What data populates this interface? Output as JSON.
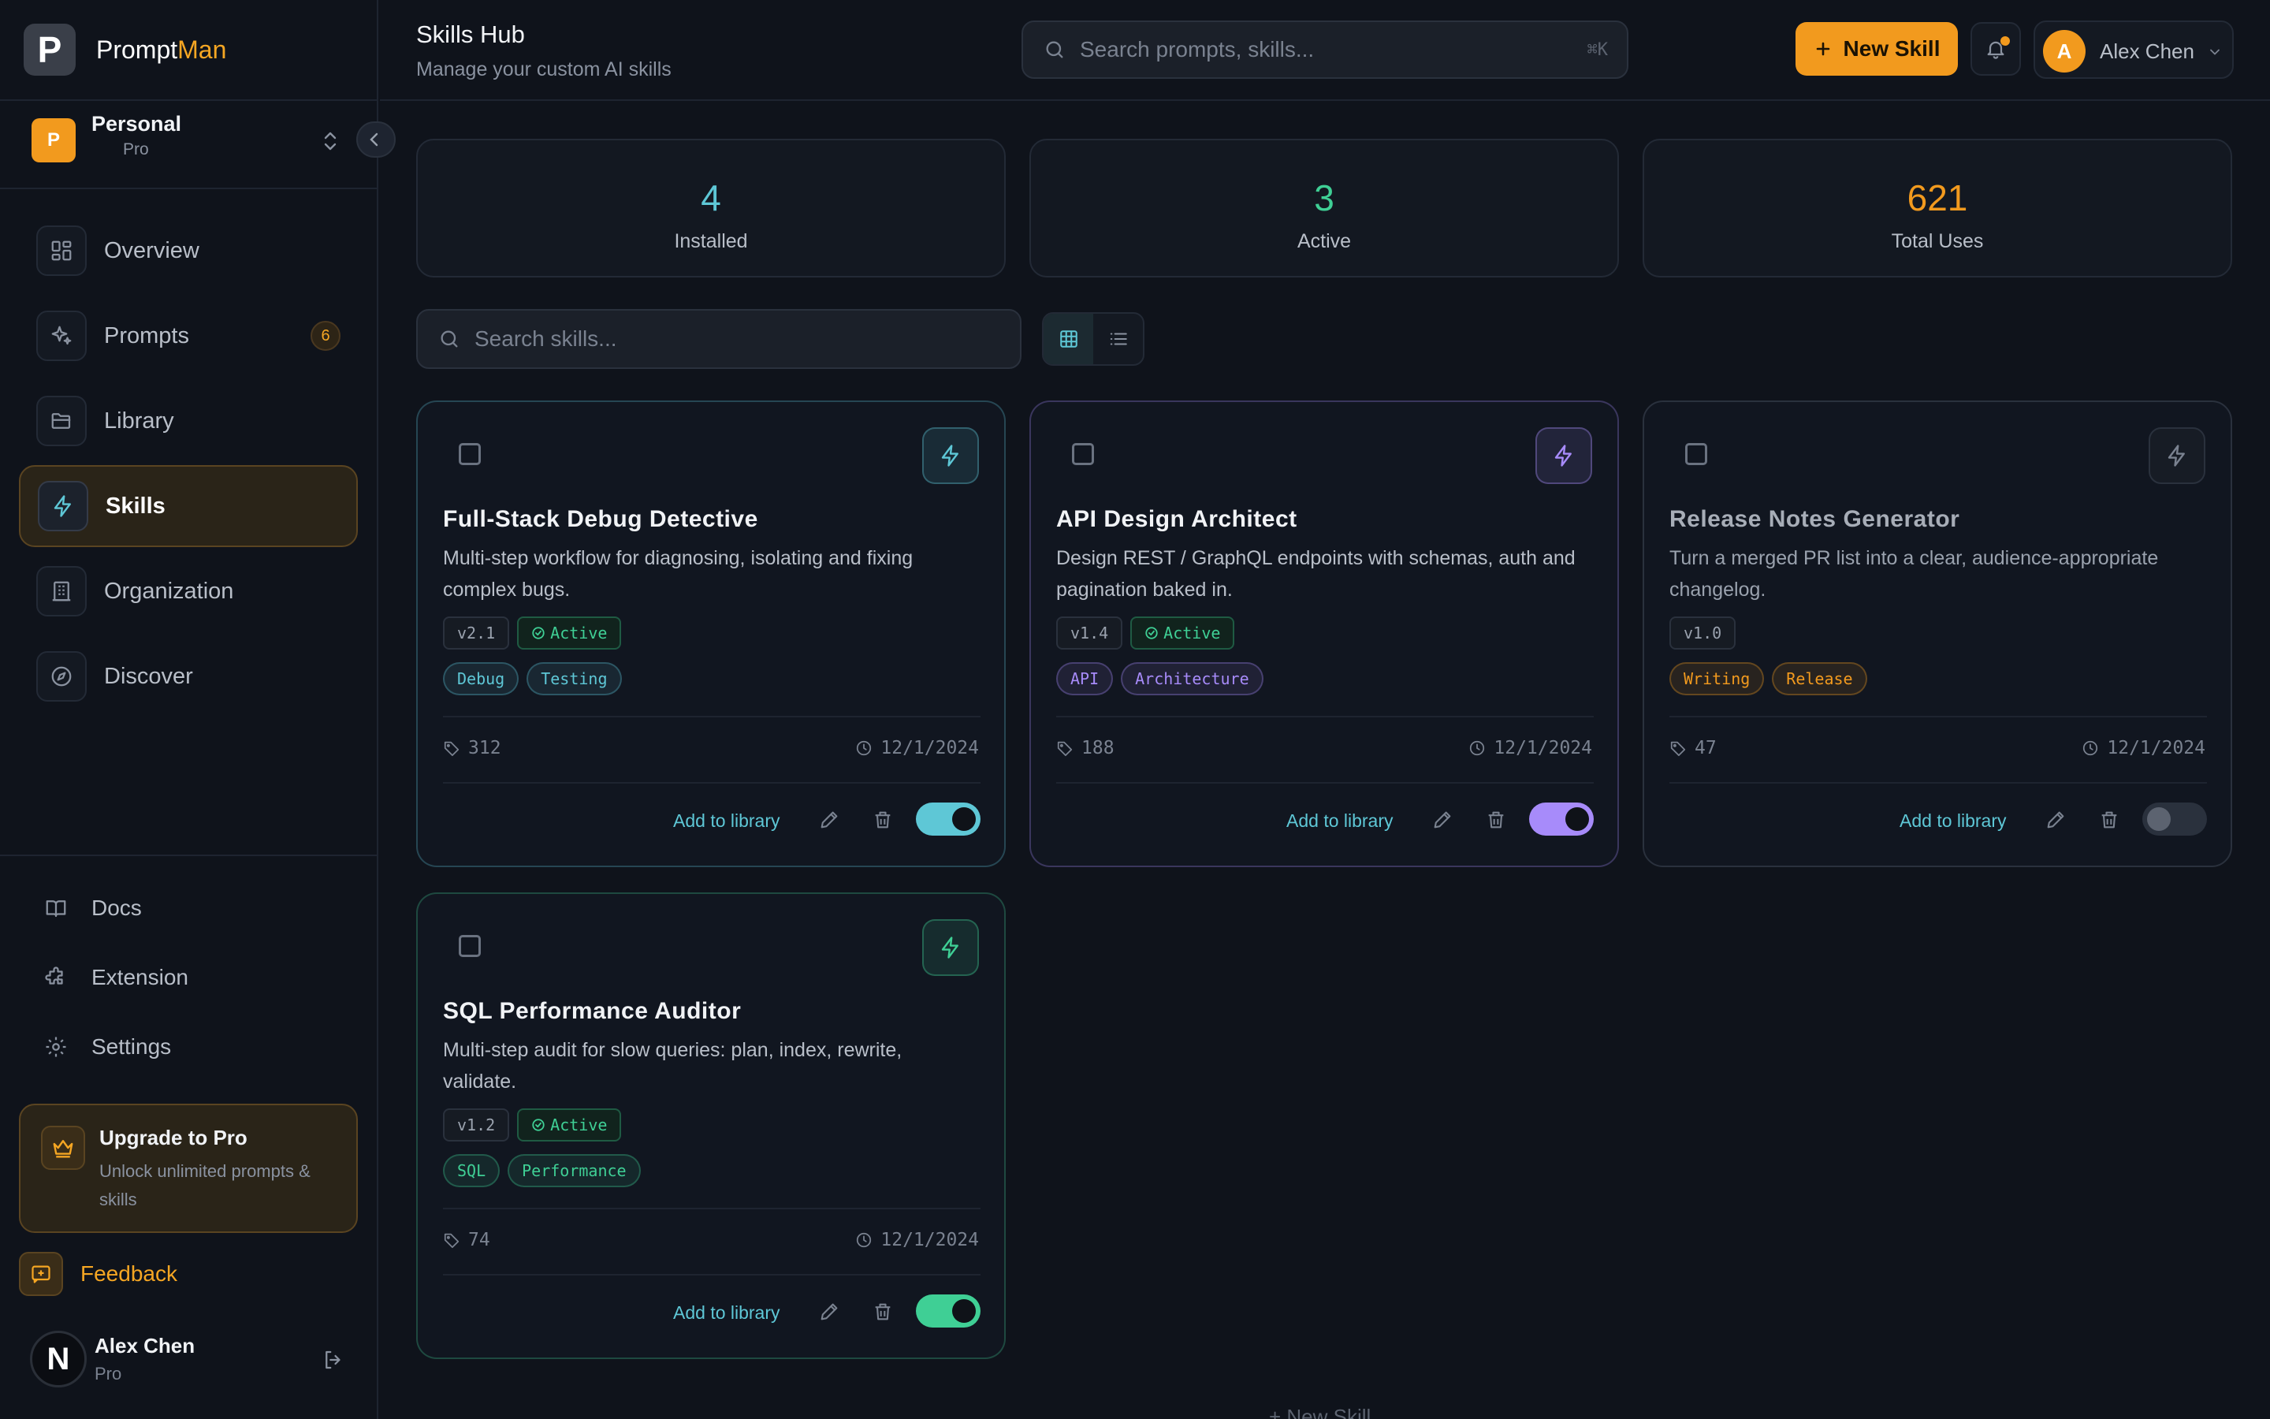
{
  "app": {
    "name_prefix": "Prompt",
    "name_accent": "Man",
    "logo_letter": "P"
  },
  "workspace": {
    "initial": "P",
    "name": "Personal",
    "plan": "Pro"
  },
  "nav": [
    {
      "label": "Overview",
      "icon": "dashboard-icon"
    },
    {
      "label": "Prompts",
      "icon": "sparkles-icon",
      "badge": "6"
    },
    {
      "label": "Library",
      "icon": "folder-icon"
    },
    {
      "label": "Skills",
      "icon": "bolt-icon",
      "active": true
    },
    {
      "label": "Organization",
      "icon": "building-icon"
    },
    {
      "label": "Discover",
      "icon": "compass-icon"
    }
  ],
  "footer_nav": [
    {
      "label": "Docs",
      "icon": "book-icon"
    },
    {
      "label": "Extension",
      "icon": "puzzle-icon"
    },
    {
      "label": "Settings",
      "icon": "gear-icon"
    }
  ],
  "upgrade": {
    "title": "Upgrade to Pro",
    "description": "Unlock unlimited prompts & skills"
  },
  "feedback": {
    "label": "Feedback"
  },
  "sidebar_user": {
    "initial": "N",
    "name": "Alex Chen",
    "plan": "Pro"
  },
  "header": {
    "title": "Skills Hub",
    "subtitle": "Manage your custom AI skills",
    "search_placeholder": "Search prompts, skills...",
    "search_shortcut": "⌘K",
    "new_skill_label": "New Skill",
    "user_initial": "A",
    "user_name": "Alex Chen"
  },
  "stats": [
    {
      "value": "4",
      "label": "Installed",
      "color": "#5ec7d6"
    },
    {
      "value": "3",
      "label": "Active",
      "color": "#3fcf95"
    },
    {
      "value": "621",
      "label": "Total Uses",
      "color": "#f29a1e"
    }
  ],
  "skills_search_placeholder": "Search skills...",
  "cards": [
    {
      "title": "Full-Stack Debug Detective",
      "description": "Multi-step workflow for diagnosing, isolating and fixing complex bugs.",
      "version": "v2.1",
      "status": "Active",
      "tags": [
        "Debug",
        "Testing"
      ],
      "tag_color": "#5ec7d6",
      "uses": "312",
      "date": "12/1/2024",
      "add_label": "Add to library",
      "enabled": true,
      "accent": "#5ec7d6"
    },
    {
      "title": "API Design Architect",
      "description": "Design REST / GraphQL endpoints with schemas, auth and pagination baked in.",
      "version": "v1.4",
      "status": "Active",
      "tags": [
        "API",
        "Architecture"
      ],
      "tag_color": "#a78bfa",
      "uses": "188",
      "date": "12/1/2024",
      "add_label": "Add to library",
      "enabled": true,
      "accent": "#a78bfa"
    },
    {
      "title": "Release Notes Generator",
      "description": "Turn a merged PR list into a clear, audience-appropriate changelog.",
      "version": "v1.0",
      "status": "",
      "tags": [
        "Writing",
        "Release"
      ],
      "tag_color": "#f29a1e",
      "uses": "47",
      "date": "12/1/2024",
      "add_label": "Add to library",
      "enabled": false,
      "accent": "#7a8290"
    },
    {
      "title": "SQL Performance Auditor",
      "description": "Multi-step audit for slow queries: plan, index, rewrite, validate.",
      "version": "v1.2",
      "status": "Active",
      "tags": [
        "SQL",
        "Performance"
      ],
      "tag_color": "#3fcf95",
      "uses": "74",
      "date": "12/1/2024",
      "add_label": "Add to library",
      "enabled": true,
      "accent": "#3fcf95"
    }
  ],
  "bottom_new_skill": "+ New Skill"
}
